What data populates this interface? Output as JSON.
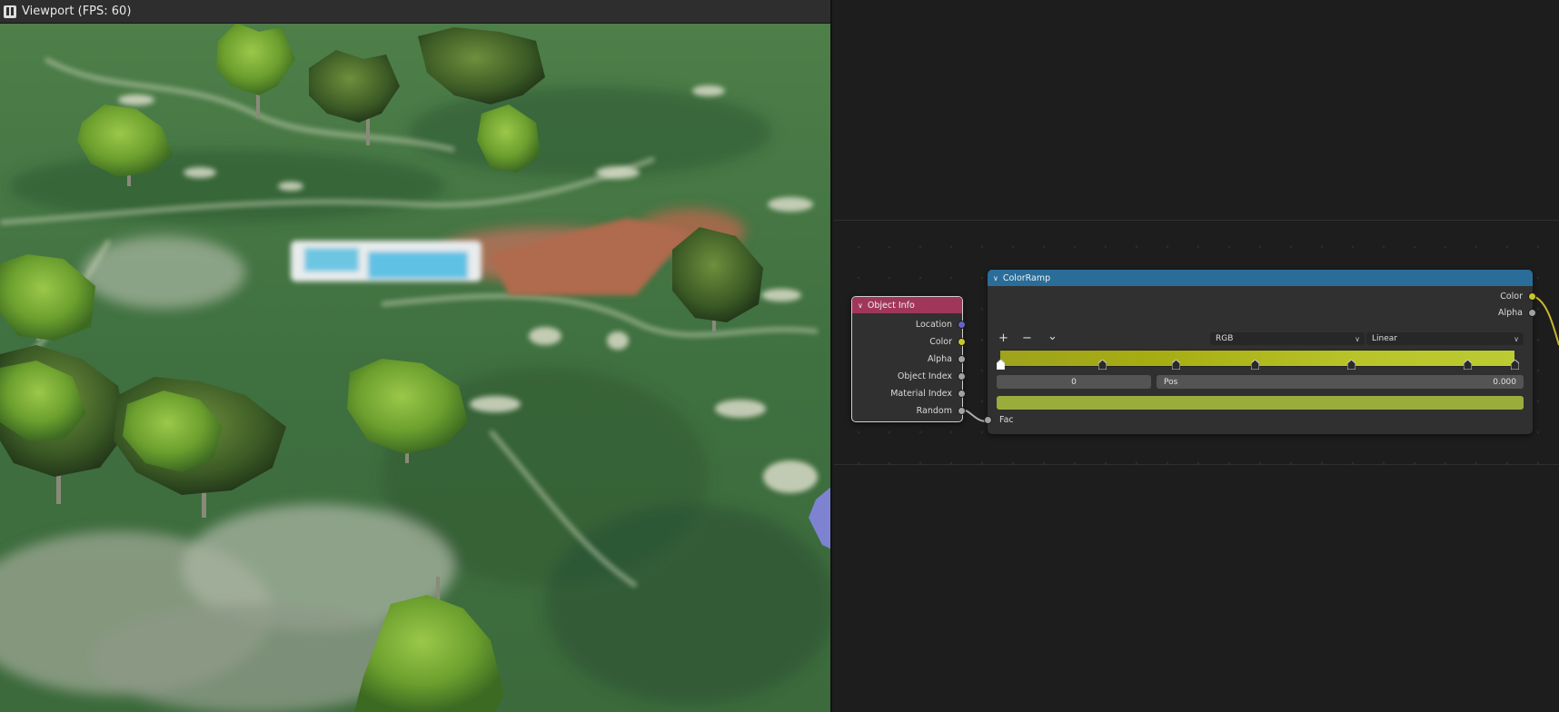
{
  "viewport": {
    "title": "Viewport (FPS: 60)",
    "icon": "pause-icon"
  },
  "nodes": {
    "object_info": {
      "title": "Object Info",
      "header_color": "#a0375a",
      "outputs": [
        {
          "label": "Location",
          "socket_color": "#6363c7"
        },
        {
          "label": "Color",
          "socket_color": "#c7c729"
        },
        {
          "label": "Alpha",
          "socket_color": "#a1a1a1"
        },
        {
          "label": "Object Index",
          "socket_color": "#a1a1a1"
        },
        {
          "label": "Material Index",
          "socket_color": "#a1a1a1"
        },
        {
          "label": "Random",
          "socket_color": "#a1a1a1"
        }
      ]
    },
    "color_ramp": {
      "title": "ColorRamp",
      "header_color": "#2a6d99",
      "outputs": [
        {
          "label": "Color",
          "socket_color": "#c7c729"
        },
        {
          "label": "Alpha",
          "socket_color": "#a1a1a1"
        }
      ],
      "add_label": "+",
      "remove_label": "−",
      "menu_label": "⌄",
      "color_mode": "RGB",
      "interpolation": "Linear",
      "active_index": "0",
      "pos_label": "Pos",
      "pos_value": "0.000",
      "fac_label": "Fac",
      "active_color": "#9aad3c",
      "stop_count": 7
    }
  },
  "colors": {
    "link_yellow": "#c9b52a",
    "link_gray": "#b0b0b0"
  }
}
